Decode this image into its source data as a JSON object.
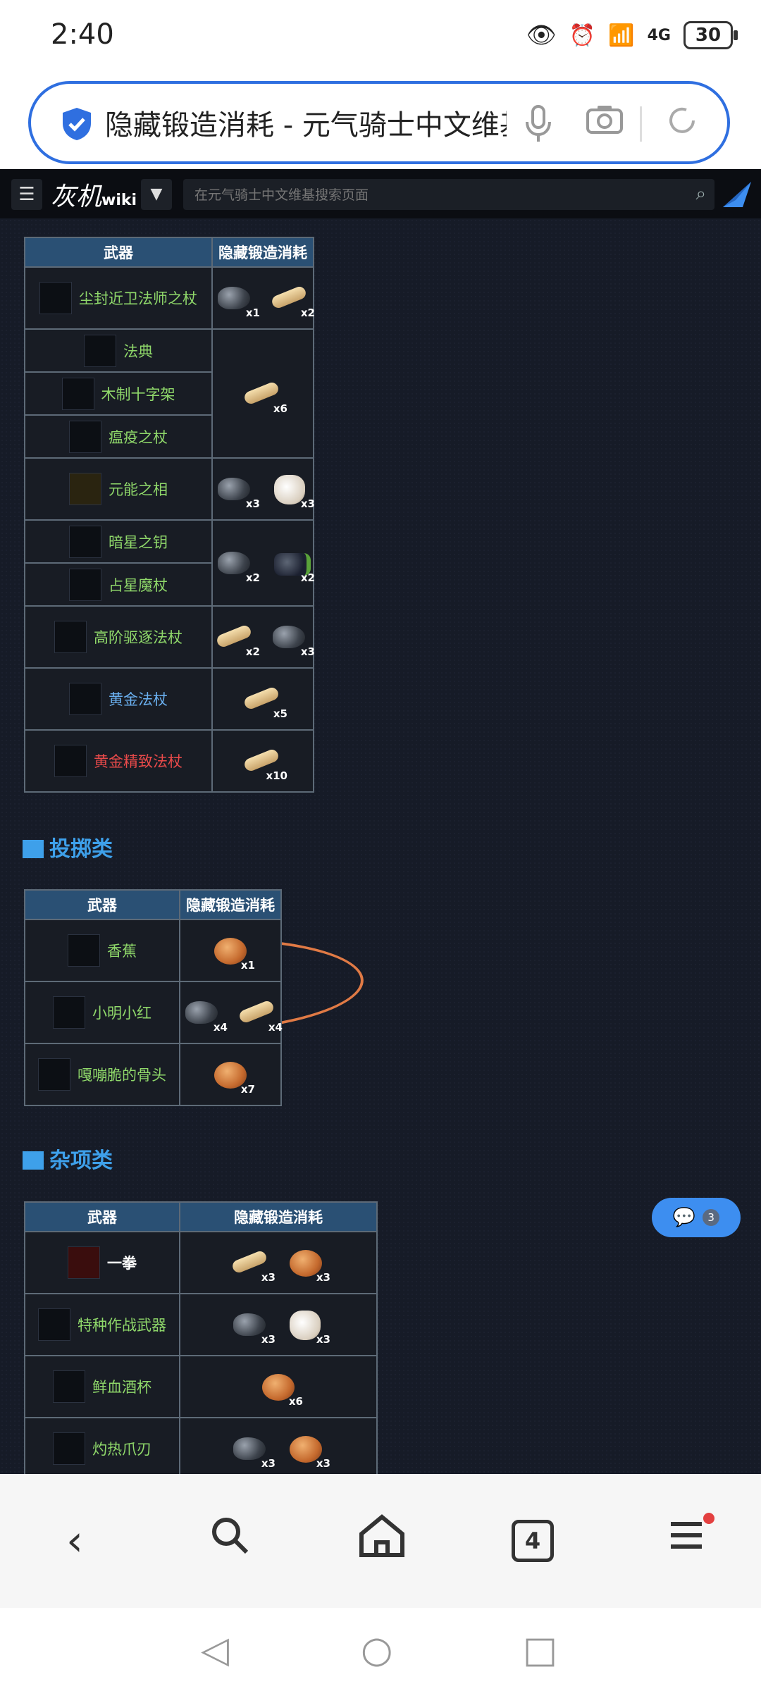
{
  "status": {
    "time": "2:40",
    "battery": "30",
    "network": "4G"
  },
  "browser": {
    "url_title": "隐藏锻造消耗 - 元气骑士中文维基",
    "tab_count": "4"
  },
  "wiki": {
    "logo": "灰机",
    "logo_sub": "wiki",
    "search_placeholder": "在元气骑士中文维基搜索页面"
  },
  "table1": {
    "headers": [
      "武器",
      "隐藏锻造消耗"
    ],
    "rows": [
      {
        "name": "尘封近卫法师之杖",
        "cost": [
          {
            "mat": "ore",
            "q": "x1"
          },
          {
            "mat": "wood",
            "q": "x2"
          }
        ]
      },
      {
        "name": "法典"
      },
      {
        "name": "木制十字架",
        "cost": [
          {
            "mat": "wood",
            "q": "x6"
          }
        ]
      },
      {
        "name": "瘟疫之杖"
      },
      {
        "name": "元能之相",
        "cost": [
          {
            "mat": "ore",
            "q": "x3"
          },
          {
            "mat": "cloth",
            "q": "x3"
          }
        ]
      },
      {
        "name": "暗星之钥"
      },
      {
        "name": "占星魔杖",
        "cost": [
          {
            "mat": "ore",
            "q": "x2"
          },
          {
            "mat": "battery",
            "q": "x2"
          }
        ]
      },
      {
        "name": "高阶驱逐法杖",
        "cost": [
          {
            "mat": "wood",
            "q": "x2"
          },
          {
            "mat": "ore",
            "q": "x3"
          }
        ]
      },
      {
        "name": "黄金法杖",
        "cost": [
          {
            "mat": "wood",
            "q": "x5"
          }
        ]
      },
      {
        "name": "黄金精致法杖",
        "cost": [
          {
            "mat": "wood",
            "q": "x10"
          }
        ]
      }
    ]
  },
  "section2": {
    "title": "投掷类"
  },
  "table2": {
    "headers": [
      "武器",
      "隐藏锻造消耗"
    ],
    "rows": [
      {
        "name": "香蕉",
        "cost": [
          {
            "mat": "meat",
            "q": "x1"
          }
        ]
      },
      {
        "name": "小明小红",
        "cost": [
          {
            "mat": "ore",
            "q": "x4"
          },
          {
            "mat": "wood",
            "q": "x4"
          }
        ]
      },
      {
        "name": "嘎嘣脆的骨头",
        "cost": [
          {
            "mat": "meat",
            "q": "x7"
          }
        ]
      }
    ]
  },
  "section3": {
    "title": "杂项类"
  },
  "table3": {
    "headers": [
      "武器",
      "隐藏锻造消耗"
    ],
    "rows": [
      {
        "name": "一拳",
        "cost": [
          {
            "mat": "wood",
            "q": "x3"
          },
          {
            "mat": "meat",
            "q": "x3"
          }
        ]
      },
      {
        "name": "特种作战武器",
        "cost": [
          {
            "mat": "ore",
            "q": "x3"
          },
          {
            "mat": "cloth",
            "q": "x3"
          }
        ]
      },
      {
        "name": "鲜血酒杯",
        "cost": [
          {
            "mat": "meat",
            "q": "x6"
          }
        ]
      },
      {
        "name": "灼热爪刃",
        "cost": [
          {
            "mat": "ore",
            "q": "x3"
          },
          {
            "mat": "meat",
            "q": "x3"
          }
        ]
      }
    ]
  },
  "chat": {
    "count": "3"
  },
  "colors": {
    "accent": "#2f6fe0",
    "link_green": "#8fd86a",
    "link_blue": "#6ab0f0",
    "red_link": "#e84a4a",
    "header_bg": "#2a5074",
    "page_bg": "#161b27",
    "highlight": "#e07a45"
  },
  "icons": [
    "shield-icon",
    "eye-icon",
    "alarm-icon",
    "wifi-icon",
    "signal-icon",
    "battery-icon",
    "mic-icon",
    "camera-icon",
    "refresh-icon",
    "menu-icon",
    "search-icon",
    "home-icon",
    "back-icon"
  ]
}
